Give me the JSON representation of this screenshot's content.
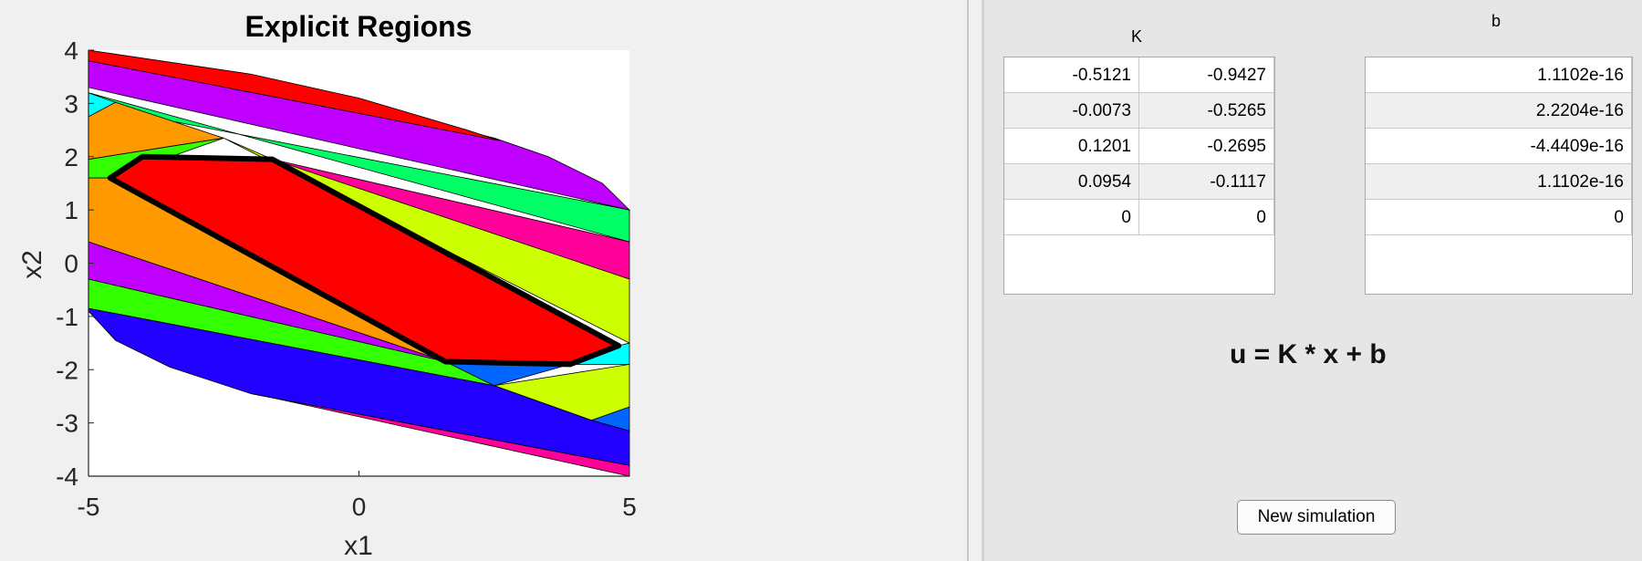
{
  "plot": {
    "title": "Explicit Regions",
    "xlabel": "x1",
    "ylabel": "x2",
    "xticks": [
      "-5",
      "0",
      "5"
    ],
    "yticks": [
      "4",
      "3",
      "2",
      "1",
      "0",
      "-1",
      "-2",
      "-3",
      "-4"
    ],
    "region_colors": {
      "red": "#ff0000",
      "magenta": "#bf00ff",
      "cyan": "#00ffff",
      "orange": "#ff9900",
      "green": "#33ff00",
      "spring_green": "#00ff66",
      "pink": "#ff0099",
      "lime": "#ccff00",
      "blue": "#2200ff",
      "azure": "#0066ff",
      "outline": "#000000"
    }
  },
  "chart_data": {
    "type": "region-partition",
    "title": "Explicit Regions",
    "xlabel": "x1",
    "ylabel": "x2",
    "xlim": [
      -5,
      5
    ],
    "ylim": [
      -4,
      4
    ],
    "highlighted_region_vertices": [
      [
        -4.6,
        1.6
      ],
      [
        -4.0,
        2.0
      ],
      [
        -1.6,
        1.95
      ],
      [
        4.8,
        -1.55
      ],
      [
        3.9,
        -1.9
      ],
      [
        1.6,
        -1.85
      ]
    ]
  },
  "K_table": {
    "title": "K",
    "rows": [
      [
        "-0.5121",
        "-0.9427"
      ],
      [
        "-0.0073",
        "-0.5265"
      ],
      [
        "0.1201",
        "-0.2695"
      ],
      [
        "0.0954",
        "-0.1117"
      ],
      [
        "0",
        "0"
      ]
    ]
  },
  "b_table": {
    "title": "b",
    "rows": [
      "1.1102e-16",
      "2.2204e-16",
      "-4.4409e-16",
      "1.1102e-16",
      "0"
    ]
  },
  "formula": "u = K * x + b",
  "actions": {
    "new_simulation_label": "New simulation"
  }
}
